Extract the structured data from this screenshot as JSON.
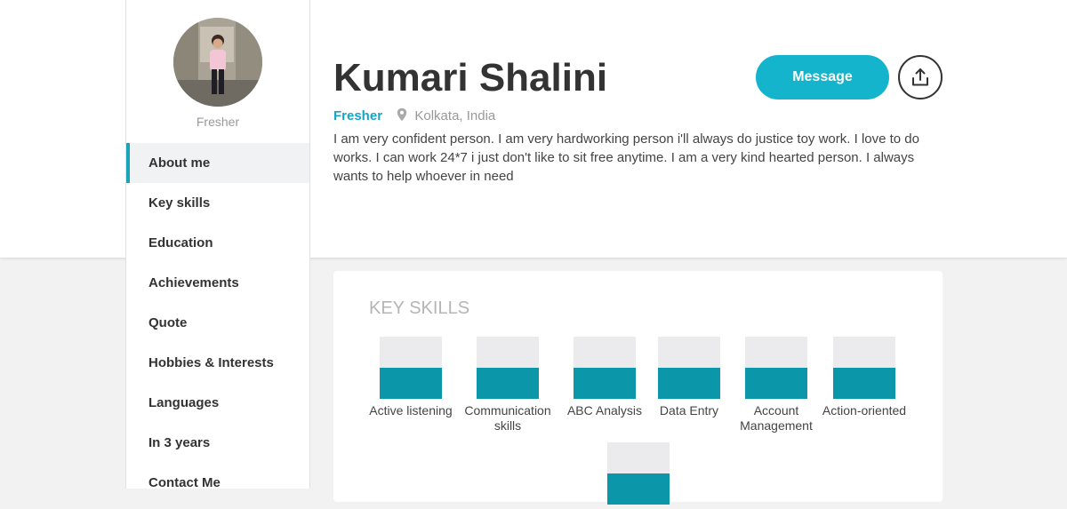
{
  "profile": {
    "name": "Kumari Shalini",
    "status": "Fresher",
    "location": "Kolkata, India",
    "bio": "I am very confident person. I am very hardworking person i'll always do justice toy work. I love to do works. I can work 24*7 i just don't like to sit free anytime. I am a very kind hearted person. I always wants to help whoever in need"
  },
  "sidebar": {
    "status": "Fresher",
    "items": [
      {
        "label": "About me"
      },
      {
        "label": "Key skills"
      },
      {
        "label": "Education"
      },
      {
        "label": "Achievements"
      },
      {
        "label": "Quote"
      },
      {
        "label": "Hobbies & Interests"
      },
      {
        "label": "Languages"
      },
      {
        "label": "In 3 years"
      },
      {
        "label": "Contact Me"
      }
    ]
  },
  "actions": {
    "message_label": "Message"
  },
  "skills": {
    "title": "KEY SKILLS",
    "items": [
      {
        "label": "Active listening"
      },
      {
        "label": "Communication skills"
      },
      {
        "label": "ABC Analysis"
      },
      {
        "label": "Data Entry"
      },
      {
        "label": "Account Management"
      },
      {
        "label": "Action-oriented"
      },
      {
        "label": ""
      }
    ]
  },
  "colors": {
    "accent": "#14b4cc",
    "skill_bar": "#0b97a9",
    "skill_bg": "#ebebed"
  }
}
